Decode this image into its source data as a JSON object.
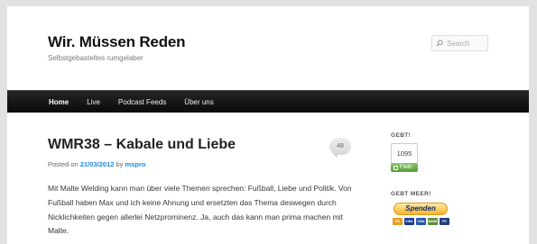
{
  "header": {
    "title": "Wir. Müssen Reden",
    "description": "Selbstgebasteltes rumgelaber",
    "search_placeholder": "Search"
  },
  "nav": {
    "items": [
      {
        "label": "Home"
      },
      {
        "label": "Live"
      },
      {
        "label": "Podcast Feeds"
      },
      {
        "label": "Über uns"
      }
    ]
  },
  "post": {
    "title": "WMR38 – Kabale und Liebe",
    "posted_on_label": "Posted on",
    "date": "21/03/2012",
    "by_label": "by",
    "author": "mspro",
    "comment_count": "48",
    "body": "Mit Malte Welding kann man über viele Themen sprechen: Fußball, Liebe und Politik. Von Fußball haben Max und ich keine Ahnung und ersetzten das Thema deswegen durch Nicklichkeiten gegen allerlei Netzprominenz. Ja, auch das kann man prima machen mit Malte."
  },
  "sidebar": {
    "flattr_title": "GEBT!",
    "flattr_count": "1095",
    "flattr_label": "Flattr",
    "paypal_title": "GEBT MEER!",
    "paypal_button": "Spenden",
    "cards": [
      {
        "name": "MasterCard",
        "label": "MC",
        "color": "#e8a021"
      },
      {
        "name": "Visa",
        "label": "VISA",
        "color": "#1a3c8e"
      },
      {
        "name": "Visa Electron",
        "label": "VISA",
        "color": "#2456a8"
      },
      {
        "name": "Bank",
        "label": "BANK",
        "color": "#5f8c3c"
      },
      {
        "name": "PayPal",
        "label": "PP",
        "color": "#213f7e"
      }
    ]
  },
  "colors": {
    "link": "#1b8be0",
    "nav_bg": "#0a0a0a",
    "flattr_green": "#5a9b3b"
  }
}
